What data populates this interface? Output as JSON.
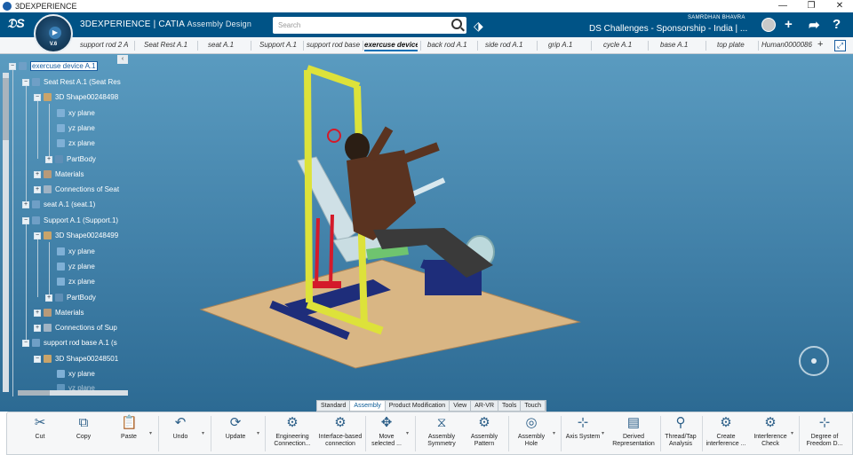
{
  "window": {
    "title": "3DEXPERIENCE",
    "controls": [
      "—",
      "❐",
      "✕"
    ]
  },
  "compass": {
    "version": "V.6"
  },
  "topbar": {
    "brand": "3DEXPERIENCE | CATIA",
    "app": "Assembly Design",
    "search_placeholder": "Search",
    "user": "SAMRDHAN BHAVRA",
    "space": "DS Challenges - Sponsorship - India | ...",
    "icons": [
      "tag-icon",
      "add-icon",
      "share-icon",
      "help-icon"
    ]
  },
  "tabs": [
    {
      "label": "support rod 2 A",
      "active": false
    },
    {
      "label": "Seat Rest A.1",
      "active": false
    },
    {
      "label": "seat A.1",
      "active": false
    },
    {
      "label": "Support A.1",
      "active": false
    },
    {
      "label": "support rod base",
      "active": false
    },
    {
      "label": "exercuse device",
      "active": true
    },
    {
      "label": "back rod A.1",
      "active": false
    },
    {
      "label": "side rod A.1",
      "active": false
    },
    {
      "label": "grip A.1",
      "active": false
    },
    {
      "label": "cycle A.1",
      "active": false
    },
    {
      "label": "base A.1",
      "active": false
    },
    {
      "label": "top plate",
      "active": false
    },
    {
      "label": "Human0000086",
      "active": false
    }
  ],
  "tabs_add": "+",
  "tree": [
    {
      "label": "exercuse device A.1"
    },
    {
      "label": "Seat Rest A.1 (Seat Res"
    },
    {
      "label": "3D Shape00248498"
    },
    {
      "label": "xy plane"
    },
    {
      "label": "yz plane"
    },
    {
      "label": "zx plane"
    },
    {
      "label": "PartBody"
    },
    {
      "label": "Materials"
    },
    {
      "label": "Connections of Seat"
    },
    {
      "label": "seat A.1 (seat.1)"
    },
    {
      "label": "Support A.1 (Support.1)"
    },
    {
      "label": "3D Shape00248499"
    },
    {
      "label": "xy plane"
    },
    {
      "label": "yz plane"
    },
    {
      "label": "zx plane"
    },
    {
      "label": "PartBody"
    },
    {
      "label": "Materials"
    },
    {
      "label": "Connections of Sup"
    },
    {
      "label": "support rod base A.1 (s"
    },
    {
      "label": "3D Shape00248501"
    },
    {
      "label": "xy plane"
    },
    {
      "label": "yz plane"
    }
  ],
  "section_tabs": [
    {
      "label": "Standard",
      "active": false
    },
    {
      "label": "Assembly",
      "active": true
    },
    {
      "label": "Product Modification",
      "active": false
    },
    {
      "label": "View",
      "active": false
    },
    {
      "label": "AR-VR",
      "active": false
    },
    {
      "label": "Tools",
      "active": false
    },
    {
      "label": "Touch",
      "active": false
    }
  ],
  "actions": [
    {
      "label": "Cut",
      "icon": "scissors-icon",
      "glyph": "✂"
    },
    {
      "label": "Copy",
      "icon": "copy-icon",
      "glyph": "⧉"
    },
    {
      "label": "Paste",
      "icon": "paste-icon",
      "glyph": "📋"
    },
    {
      "label": "Undo",
      "icon": "undo-icon",
      "glyph": "↶"
    },
    {
      "label": "Update",
      "icon": "update-icon",
      "glyph": "⟳"
    },
    {
      "label": "Engineering Connection...",
      "icon": "engineering-connection-icon",
      "glyph": "⚙"
    },
    {
      "label": "Interface-based connection",
      "icon": "interface-connection-icon",
      "glyph": "⚙"
    },
    {
      "label": "Move selected ...",
      "icon": "move-icon",
      "glyph": "✥"
    },
    {
      "label": "Assembly Symmetry",
      "icon": "assembly-symmetry-icon",
      "glyph": "⧖"
    },
    {
      "label": "Assembly Pattern",
      "icon": "assembly-pattern-icon",
      "glyph": "⚙"
    },
    {
      "label": "Assembly Hole",
      "icon": "assembly-hole-icon",
      "glyph": "◎"
    },
    {
      "label": "Axis System",
      "icon": "axis-system-icon",
      "glyph": "⊹"
    },
    {
      "label": "Derived Representation",
      "icon": "derived-representation-icon",
      "glyph": "▤"
    },
    {
      "label": "Thread/Tap Analysis",
      "icon": "thread-tap-icon",
      "glyph": "⚲"
    },
    {
      "label": "Create interference ...",
      "icon": "create-interference-icon",
      "glyph": "⚙"
    },
    {
      "label": "Interference Check",
      "icon": "interference-check-icon",
      "glyph": "⚙"
    },
    {
      "label": "Degree of Freedom D...",
      "icon": "degree-of-freedom-icon",
      "glyph": "⊹"
    }
  ]
}
